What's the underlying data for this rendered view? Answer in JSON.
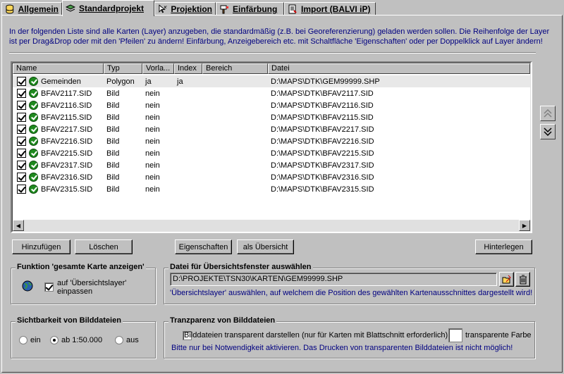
{
  "tabs": [
    {
      "label": "Allgemein",
      "icon": "database-icon"
    },
    {
      "label": "Standardprojekt",
      "icon": "layers-icon"
    },
    {
      "label": "Projektion",
      "icon": "xy-cursor-icon"
    },
    {
      "label": "Einfärbung",
      "icon": "paint-icon"
    },
    {
      "label": "Import (BALVI iP)",
      "icon": "import-icon"
    }
  ],
  "info_text": "In der folgenden Liste sind alle Karten (Layer) anzugeben, die standardmäßig (z.B. bei Georeferenzierung) geladen werden sollen. Die Reihenfolge der Layer ist per Drag&Drop oder mit den 'Pfeilen' zu ändern! Einfärbung, Anzeigebereich etc. mit Schaltfläche 'Eigenschaften' oder per Doppelklick auf Layer ändern!",
  "columns": [
    "Name",
    "Typ",
    "Vorla...",
    "Index",
    "Bereich",
    "Datei"
  ],
  "rows": [
    {
      "name": "Gemeinden",
      "typ": "Polygon",
      "vorlage": "ja",
      "index": "ja",
      "bereich": "",
      "datei": "D:\\MAPS\\DTK\\GEM99999.SHP"
    },
    {
      "name": "BFAV2117.SID",
      "typ": "Bild",
      "vorlage": "nein",
      "index": "",
      "bereich": "",
      "datei": "D:\\MAPS\\DTK\\BFAV2117.SID"
    },
    {
      "name": "BFAV2116.SID",
      "typ": "Bild",
      "vorlage": "nein",
      "index": "",
      "bereich": "",
      "datei": "D:\\MAPS\\DTK\\BFAV2116.SID"
    },
    {
      "name": "BFAV2115.SID",
      "typ": "Bild",
      "vorlage": "nein",
      "index": "",
      "bereich": "",
      "datei": "D:\\MAPS\\DTK\\BFAV2115.SID"
    },
    {
      "name": "BFAV2217.SID",
      "typ": "Bild",
      "vorlage": "nein",
      "index": "",
      "bereich": "",
      "datei": "D:\\MAPS\\DTK\\BFAV2217.SID"
    },
    {
      "name": "BFAV2216.SID",
      "typ": "Bild",
      "vorlage": "nein",
      "index": "",
      "bereich": "",
      "datei": "D:\\MAPS\\DTK\\BFAV2216.SID"
    },
    {
      "name": "BFAV2215.SID",
      "typ": "Bild",
      "vorlage": "nein",
      "index": "",
      "bereich": "",
      "datei": "D:\\MAPS\\DTK\\BFAV2215.SID"
    },
    {
      "name": "BFAV2317.SID",
      "typ": "Bild",
      "vorlage": "nein",
      "index": "",
      "bereich": "",
      "datei": "D:\\MAPS\\DTK\\BFAV2317.SID"
    },
    {
      "name": "BFAV2316.SID",
      "typ": "Bild",
      "vorlage": "nein",
      "index": "",
      "bereich": "",
      "datei": "D:\\MAPS\\DTK\\BFAV2316.SID"
    },
    {
      "name": "BFAV2315.SID",
      "typ": "Bild",
      "vorlage": "nein",
      "index": "",
      "bereich": "",
      "datei": "D:\\MAPS\\DTK\\BFAV2315.SID"
    }
  ],
  "buttons": {
    "add": "Hinzufügen",
    "delete": "Löschen",
    "properties": "Eigenschaften",
    "as_overview": "als Übersicht",
    "deposit": "Hinterlegen"
  },
  "group_full_map": {
    "title": "Funktion 'gesamte Karte anzeigen'",
    "checkbox_label_1": "auf 'Übersichtslayer'",
    "checkbox_label_2": "einpassen",
    "checked": true
  },
  "group_overview_file": {
    "title": "Datei für Übersichtsfenster auswählen",
    "value": "D:\\PROJEKTE\\TSN30\\KARTEN\\GEM99999.SHP",
    "hint": "'Übersichtslayer' auswählen, auf welchem die Position des gewählten Kartenausschnittes dargestellt wird!"
  },
  "group_visibility": {
    "title": "Sichtbarkeit von Bilddateien",
    "options": [
      "ein",
      "ab 1:50.000",
      "aus"
    ],
    "selected": "ab 1:50.000"
  },
  "group_transparency": {
    "title": "Tranzparenz von Bilddateien",
    "checkbox_label": "Bilddateien transparent darstellen (nur für Karten mit Blattschnitt erforderlich)",
    "color_label": "transparente Farbe",
    "hint": "Bitte nur bei Notwendigkeit aktivieren. Das Drucken von transparenten Bilddateien ist nicht möglich!"
  },
  "colors": {
    "accent_text": "#000080",
    "ok_icon": "#1f8a1f",
    "face": "#c0c0c0"
  }
}
